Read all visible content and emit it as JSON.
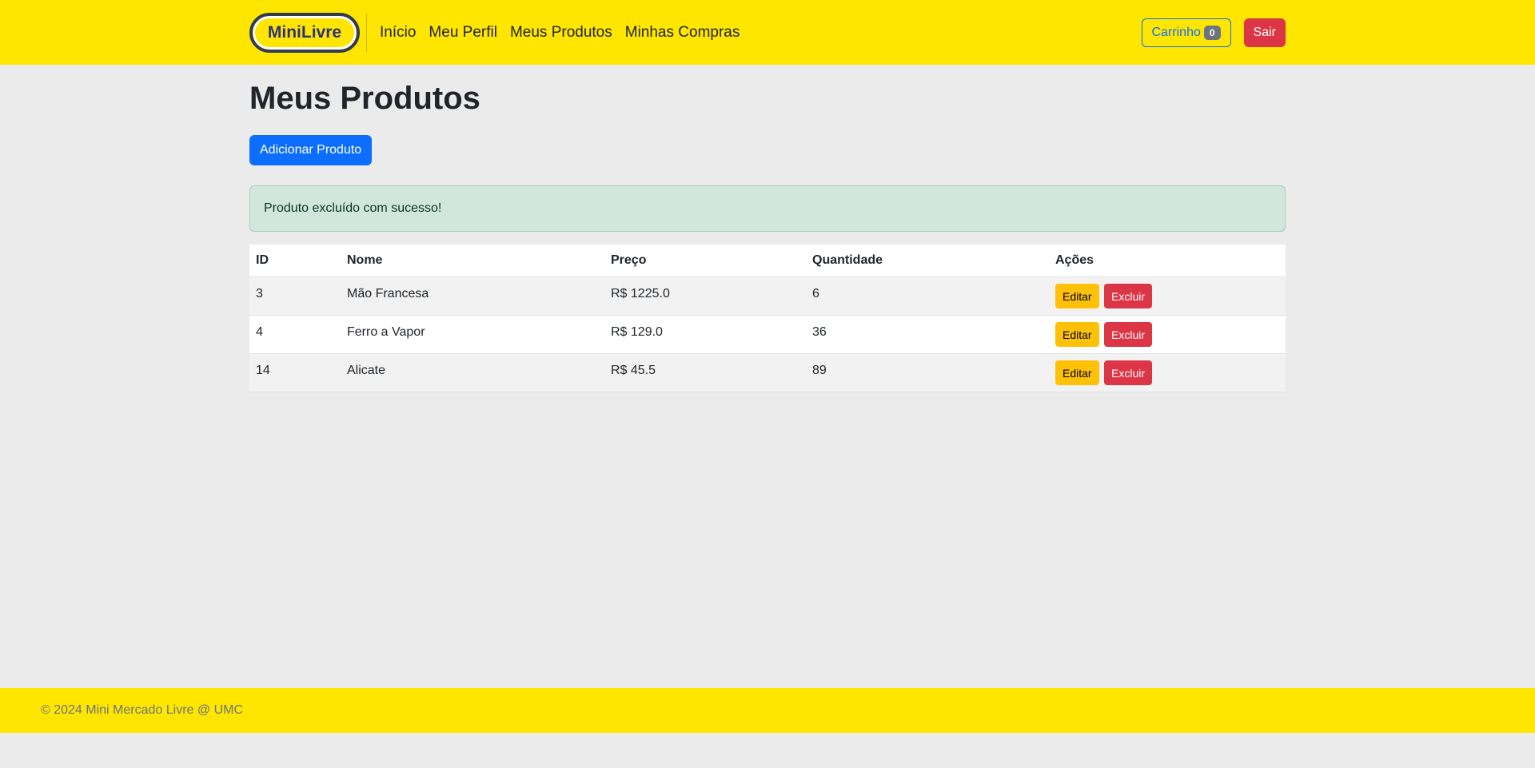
{
  "header": {
    "brand": "MiniLivre",
    "nav": [
      "Início",
      "Meu Perfil",
      "Meus Produtos",
      "Minhas Compras"
    ],
    "cart_label": "Carrinho",
    "cart_count": "0",
    "logout_label": "Sair"
  },
  "main": {
    "title": "Meus Produtos",
    "add_button": "Adicionar Produto",
    "alert": "Produto excluído com sucesso!",
    "table": {
      "columns": [
        "ID",
        "Nome",
        "Preço",
        "Quantidade",
        "Ações"
      ],
      "rows": [
        {
          "id": "3",
          "name": "Mão Francesa",
          "price": "R$ 1225.0",
          "qty": "6"
        },
        {
          "id": "4",
          "name": "Ferro a Vapor",
          "price": "R$ 129.0",
          "qty": "36"
        },
        {
          "id": "14",
          "name": "Alicate",
          "price": "R$ 45.5",
          "qty": "89"
        }
      ],
      "edit_label": "Editar",
      "delete_label": "Excluir"
    }
  },
  "footer": {
    "text": "© 2024 Mini Mercado Livre @ UMC"
  },
  "colors": {
    "header_bg": "#ffe600",
    "primary": "#0d6efd",
    "danger": "#dc3545",
    "warning": "#ffc107",
    "success_bg": "#d1e7dd"
  }
}
